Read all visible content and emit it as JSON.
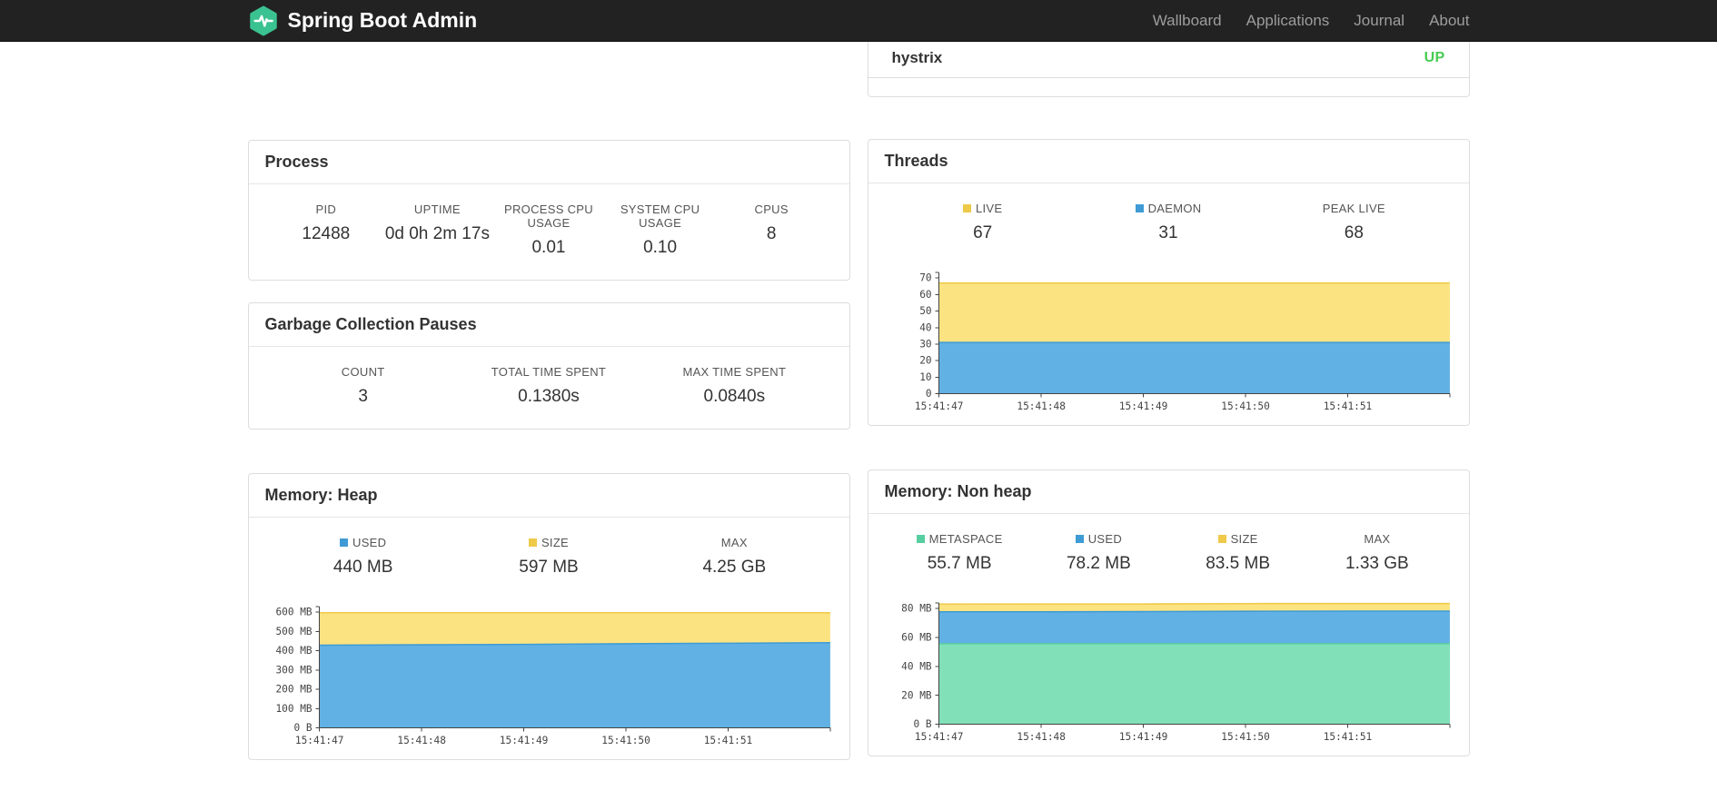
{
  "navbar": {
    "brand": "Spring Boot Admin",
    "links": [
      {
        "label": "Wallboard"
      },
      {
        "label": "Applications"
      },
      {
        "label": "Journal"
      },
      {
        "label": "About"
      }
    ]
  },
  "application_status": {
    "name": "hystrix",
    "status": "UP",
    "status_color": "#47cb51"
  },
  "panels": {
    "process": {
      "title": "Process",
      "stats": [
        {
          "label": "PID",
          "value": "12488"
        },
        {
          "label": "UPTIME",
          "value": "0d 0h 2m 17s"
        },
        {
          "label": "PROCESS CPU USAGE",
          "value": "0.01"
        },
        {
          "label": "SYSTEM CPU USAGE",
          "value": "0.10"
        },
        {
          "label": "CPUS",
          "value": "8"
        }
      ]
    },
    "gc": {
      "title": "Garbage Collection Pauses",
      "stats": [
        {
          "label": "COUNT",
          "value": "3"
        },
        {
          "label": "TOTAL TIME SPENT",
          "value": "0.1380s"
        },
        {
          "label": "MAX TIME SPENT",
          "value": "0.0840s"
        }
      ]
    },
    "threads": {
      "title": "Threads",
      "stats": [
        {
          "label": "LIVE",
          "value": "67",
          "swatch": "yellow"
        },
        {
          "label": "DAEMON",
          "value": "31",
          "swatch": "blue"
        },
        {
          "label": "PEAK LIVE",
          "value": "68"
        }
      ]
    },
    "heap": {
      "title": "Memory: Heap",
      "stats": [
        {
          "label": "USED",
          "value": "440 MB",
          "swatch": "blue"
        },
        {
          "label": "SIZE",
          "value": "597 MB",
          "swatch": "yellow"
        },
        {
          "label": "MAX",
          "value": "4.25 GB"
        }
      ]
    },
    "nonheap": {
      "title": "Memory: Non heap",
      "stats": [
        {
          "label": "METASPACE",
          "value": "55.7 MB",
          "swatch": "green"
        },
        {
          "label": "USED",
          "value": "78.2 MB",
          "swatch": "blue"
        },
        {
          "label": "SIZE",
          "value": "83.5 MB",
          "swatch": "yellow"
        },
        {
          "label": "MAX",
          "value": "1.33 GB"
        }
      ]
    }
  },
  "colors": {
    "brand": "#3bc291",
    "yellow": {
      "line": "#efc948",
      "fill": "#fbe381"
    },
    "blue": {
      "line": "#3e9bd5",
      "fill": "#61b1e4"
    },
    "green": {
      "line": "#57ce9f",
      "fill": "#82e0b8"
    }
  },
  "chart_data": [
    {
      "id": "threads",
      "type": "area",
      "title": "Threads",
      "x_labels": [
        "15:41:47",
        "15:41:48",
        "15:41:49",
        "15:41:50",
        "15:41:51"
      ],
      "y_ticks": [
        "0",
        "10",
        "20",
        "30",
        "40",
        "50",
        "60",
        "70"
      ],
      "ymax": 70,
      "series": [
        {
          "name": "LIVE",
          "color": "yellow",
          "values": [
            67,
            67,
            67,
            67,
            67,
            67
          ]
        },
        {
          "name": "DAEMON",
          "color": "blue",
          "values": [
            31,
            31,
            31,
            31,
            31,
            31
          ]
        }
      ]
    },
    {
      "id": "heap",
      "type": "area",
      "title": "Memory: Heap",
      "x_labels": [
        "15:41:47",
        "15:41:48",
        "15:41:49",
        "15:41:50",
        "15:41:51"
      ],
      "y_ticks": [
        "0 B",
        "100 MB",
        "200 MB",
        "300 MB",
        "400 MB",
        "500 MB",
        "600 MB"
      ],
      "ymax": 600,
      "series": [
        {
          "name": "SIZE",
          "color": "yellow",
          "values": [
            597,
            597,
            597,
            597,
            597,
            597
          ]
        },
        {
          "name": "USED",
          "color": "blue",
          "values": [
            429,
            431,
            433,
            436,
            439,
            442
          ]
        }
      ]
    },
    {
      "id": "nonheap",
      "type": "area",
      "title": "Memory: Non heap",
      "x_labels": [
        "15:41:47",
        "15:41:48",
        "15:41:49",
        "15:41:50",
        "15:41:51"
      ],
      "y_ticks": [
        "0 B",
        "20 MB",
        "40 MB",
        "60 MB",
        "80 MB"
      ],
      "ymax": 80,
      "series": [
        {
          "name": "SIZE",
          "color": "yellow",
          "values": [
            83.1,
            83.2,
            83.2,
            83.4,
            83.5,
            83.5
          ]
        },
        {
          "name": "USED",
          "color": "blue",
          "values": [
            77.7,
            77.8,
            77.9,
            78.1,
            78.2,
            78.2
          ]
        },
        {
          "name": "METASPACE",
          "color": "green",
          "values": [
            55.7,
            55.7,
            55.7,
            55.7,
            55.7,
            55.7
          ]
        }
      ]
    }
  ]
}
